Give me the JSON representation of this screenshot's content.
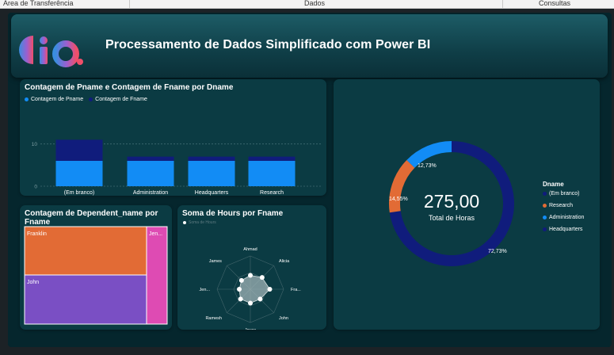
{
  "ribbon": {
    "labels": [
      "Área de Transferência",
      "Dados",
      "Consultas"
    ]
  },
  "header": {
    "title": "Processamento de Dados Simplificado com Power BI"
  },
  "colors": {
    "navy": "#101c7c",
    "blue": "#128cf5",
    "orange": "#e26b35",
    "purple": "#7a4fc4",
    "pink": "#de4bb3",
    "card": "#0b3b43",
    "canvas": "#05262d"
  },
  "bar_card": {
    "title": "Contagem de Pname e Contagem de Fname por Dname",
    "legend": [
      "Contagem de Pname",
      "Contagem de Fname"
    ]
  },
  "treemap_card": {
    "title_line1": "Contagem de Dependent_name por",
    "title_line2": "Fname",
    "labels": [
      "Franklin",
      "John",
      "Jen..."
    ]
  },
  "radar_card": {
    "title": "Soma de Hours por Fname",
    "legend": "Soma de Hours"
  },
  "donut_card": {
    "center_value": "275,00",
    "center_label": "Total de Horas",
    "legend_title": "Dname",
    "legend": [
      "(Em branco)",
      "Research",
      "Administration",
      "Headquarters"
    ],
    "slice_labels": [
      "72,73%",
      "14,55%",
      "12,73%"
    ]
  },
  "chart_data": [
    {
      "type": "bar",
      "title": "Contagem de Pname e Contagem de Fname por Dname",
      "categories": [
        "(Em branco)",
        "Administration",
        "Headquarters",
        "Research"
      ],
      "series": [
        {
          "name": "Contagem de Pname",
          "values": [
            6,
            6,
            6,
            6
          ]
        },
        {
          "name": "Contagem de Fname",
          "values": [
            11,
            7,
            7,
            7
          ]
        }
      ],
      "yticks": [
        0,
        10
      ],
      "ylim": [
        0,
        12
      ]
    },
    {
      "type": "heatmap",
      "title": "Contagem de Dependent_name por Fname",
      "categories": [
        "Franklin",
        "John",
        "Jen..."
      ],
      "values": [
        3,
        3,
        1
      ]
    },
    {
      "type": "line",
      "title": "Soma de Hours por Fname",
      "categories": [
        "Ahmad",
        "Alicia",
        "Fra...",
        "John",
        "Joyce",
        "Ramesh",
        "Jen...",
        "James"
      ],
      "values": [
        10,
        12,
        14,
        10,
        10,
        10,
        8,
        9
      ]
    },
    {
      "type": "pie",
      "categories": [
        "(Em branco)",
        "Research",
        "Administration",
        "Headquarters"
      ],
      "values": [
        72.73,
        14.55,
        12.73,
        0
      ],
      "total": "275,00"
    }
  ]
}
